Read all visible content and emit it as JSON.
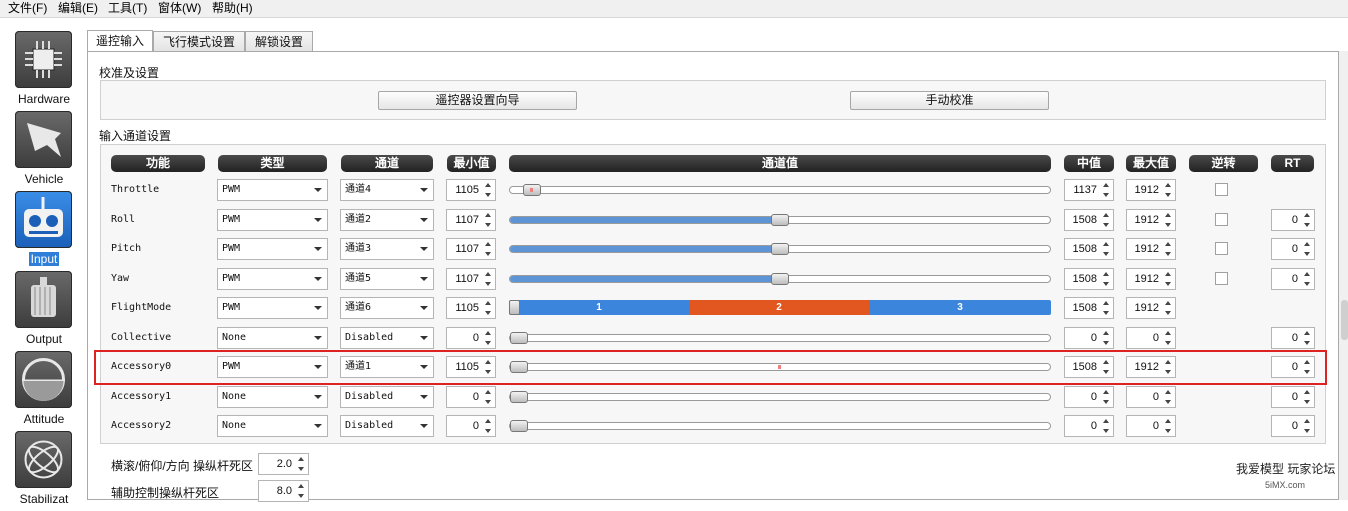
{
  "menu": [
    "文件(F)",
    "编辑(E)",
    "工具(T)",
    "窗体(W)",
    "帮助(H)"
  ],
  "sidebar": [
    {
      "label": "Hardware",
      "icon": "chip-icon",
      "active": false
    },
    {
      "label": "Vehicle",
      "icon": "airframe-icon",
      "active": false
    },
    {
      "label": "Input",
      "icon": "transmitter-icon",
      "active": true
    },
    {
      "label": "Output",
      "icon": "motor-icon",
      "active": false
    },
    {
      "label": "Attitude",
      "icon": "attitude-indicator-icon",
      "active": false
    },
    {
      "label": "Stabilizat",
      "icon": "stabilization-icon",
      "active": false
    }
  ],
  "tabs": [
    "遥控输入",
    "飞行模式设置",
    "解锁设置"
  ],
  "calibration": {
    "title": "校准及设置",
    "wizard_button": "遥控器设置向导",
    "manual_button": "手动校准"
  },
  "channels_section": {
    "title": "输入通道设置",
    "headers": [
      "功能",
      "类型",
      "通道",
      "最小值",
      "通道值",
      "中值",
      "最大值",
      "逆转",
      "RT"
    ]
  },
  "rows": [
    {
      "name": "Throttle",
      "type": "PWM",
      "channel": "通道4",
      "min": "1105",
      "neutral": "1137",
      "max": "1912",
      "value_fraction": 0.04,
      "reversed": false,
      "rt": ""
    },
    {
      "name": "Roll",
      "type": "PWM",
      "channel": "通道2",
      "min": "1107",
      "neutral": "1508",
      "max": "1912",
      "value_fraction": 0.5,
      "reversed": false,
      "rt": "0"
    },
    {
      "name": "Pitch",
      "type": "PWM",
      "channel": "通道3",
      "min": "1107",
      "neutral": "1508",
      "max": "1912",
      "value_fraction": 0.5,
      "reversed": false,
      "rt": "0"
    },
    {
      "name": "Yaw",
      "type": "PWM",
      "channel": "通道5",
      "min": "1107",
      "neutral": "1508",
      "max": "1912",
      "value_fraction": 0.5,
      "reversed": false,
      "rt": "0"
    },
    {
      "name": "FlightMode",
      "type": "PWM",
      "channel": "通道6",
      "min": "1105",
      "neutral": "1508",
      "max": "1912",
      "value_fraction": 0.0,
      "reversed": null,
      "rt": "",
      "segments": [
        "1",
        "2",
        "3"
      ]
    },
    {
      "name": "Collective",
      "type": "None",
      "channel": "Disabled",
      "min": "0",
      "neutral": "0",
      "max": "0",
      "value_fraction": 0.0,
      "reversed": null,
      "rt": "0"
    },
    {
      "name": "Accessory0",
      "type": "PWM",
      "channel": "通道1",
      "min": "1105",
      "neutral": "1508",
      "max": "1912",
      "value_fraction": 0.0,
      "reversed": null,
      "rt": "0"
    },
    {
      "name": "Accessory1",
      "type": "None",
      "channel": "Disabled",
      "min": "0",
      "neutral": "0",
      "max": "0",
      "value_fraction": 0.0,
      "reversed": null,
      "rt": "0"
    },
    {
      "name": "Accessory2",
      "type": "None",
      "channel": "Disabled",
      "min": "0",
      "neutral": "0",
      "max": "0",
      "value_fraction": 0.0,
      "reversed": null,
      "rt": "0"
    }
  ],
  "deadband": {
    "stick_label": "横滚/俯仰/方向 操纵杆死区",
    "stick_value": "2.0",
    "aux_label": "辅助控制操纵杆死区",
    "aux_value": "8.0"
  },
  "watermark": {
    "line1": "我爱模型 玩家论坛",
    "line2": "5iMX.com"
  },
  "colors": {
    "accent": "#2f7fd9",
    "seg1": "#3b86dc",
    "seg2": "#e2571f",
    "seg3": "#3b86dc",
    "highlight": "#dd2222"
  }
}
